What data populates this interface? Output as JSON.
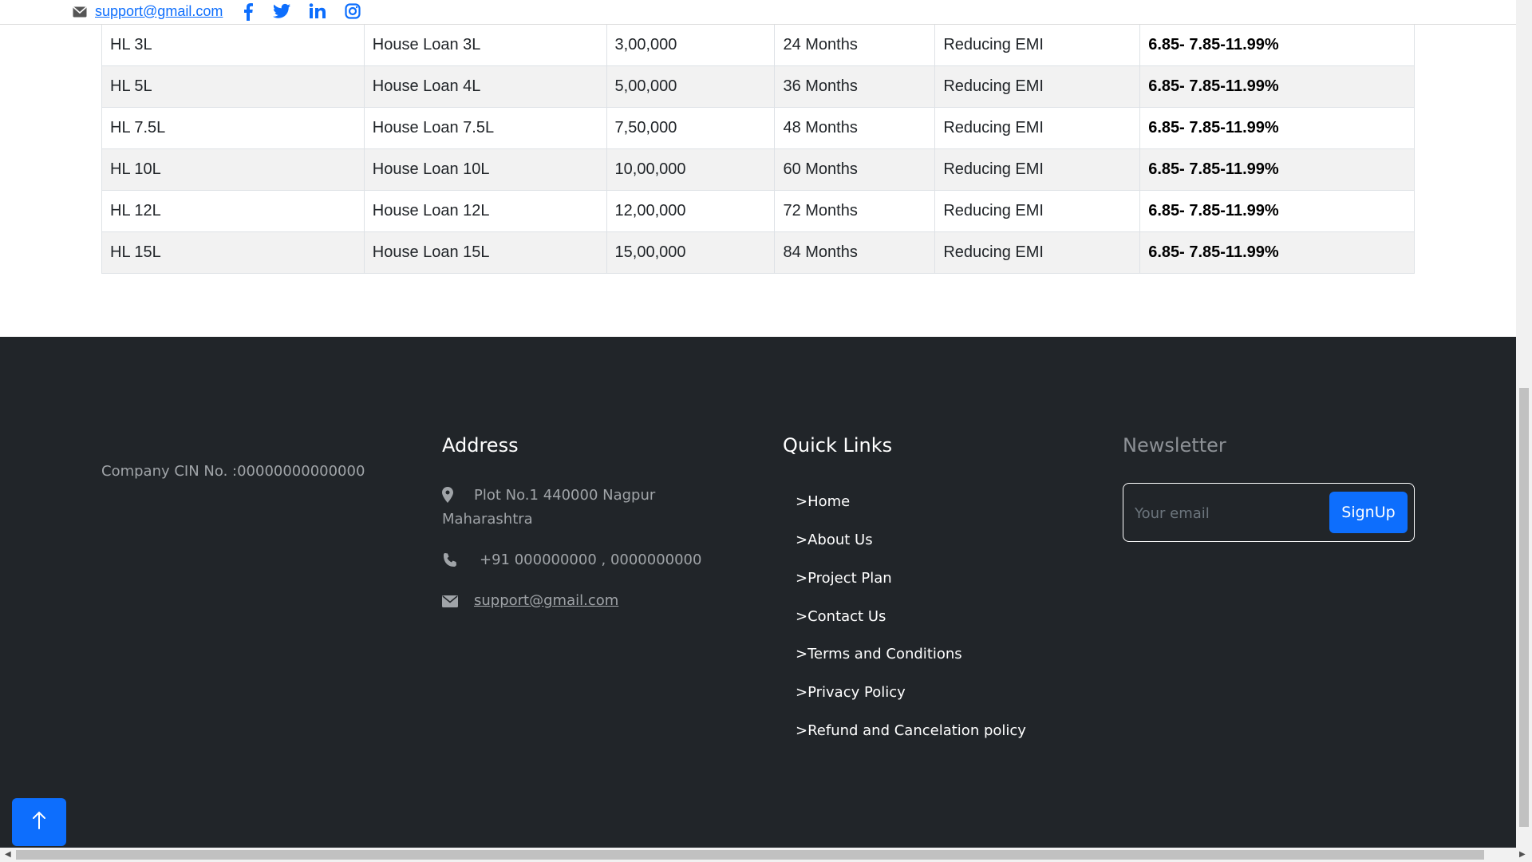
{
  "topbar": {
    "email": "support@gmail.com",
    "social": [
      "facebook-icon",
      "twitter-icon",
      "linkedin-icon",
      "instagram-icon"
    ]
  },
  "loan_table": {
    "rows": [
      [
        "HL 3L",
        "House Loan 3L",
        "3,00,000",
        "24 Months",
        "Reducing EMI",
        "6.85- 7.85-11.99%"
      ],
      [
        "HL 5L",
        "House Loan 4L",
        "5,00,000",
        "36 Months",
        "Reducing EMI",
        "6.85- 7.85-11.99%"
      ],
      [
        "HL 7.5L",
        "House Loan 7.5L",
        "7,50,000",
        "48 Months",
        "Reducing EMI",
        "6.85- 7.85-11.99%"
      ],
      [
        "HL 10L",
        "House Loan 10L",
        "10,00,000",
        "60 Months",
        "Reducing EMI",
        "6.85- 7.85-11.99%"
      ],
      [
        "HL 12L",
        "House Loan 12L",
        "12,00,000",
        "72 Months",
        "Reducing EMI",
        "6.85- 7.85-11.99%"
      ],
      [
        "HL 15L",
        "House Loan 15L",
        "15,00,000",
        "84 Months",
        "Reducing EMI",
        "6.85- 7.85-11.99%"
      ]
    ]
  },
  "footer": {
    "cin": "Company CIN No. :00000000000000",
    "address": {
      "title": "Address",
      "line1": "Plot No.1 440000 Nagpur",
      "line2": "Maharashtra",
      "phone": "+91 000000000 , 0000000000",
      "email": "support@gmail.com"
    },
    "quick_links": {
      "title": "Quick Links",
      "items": [
        ">Home",
        ">About Us",
        ">Project Plan",
        ">Contact Us",
        ">Terms and Conditions",
        ">Privacy Policy",
        ">Refund and Cancelation policy"
      ]
    },
    "newsletter": {
      "title": "Newsletter",
      "placeholder": "Your email",
      "button": "SignUp"
    }
  },
  "colors": {
    "accent": "#0d6efd",
    "footer_bg": "#212529"
  }
}
